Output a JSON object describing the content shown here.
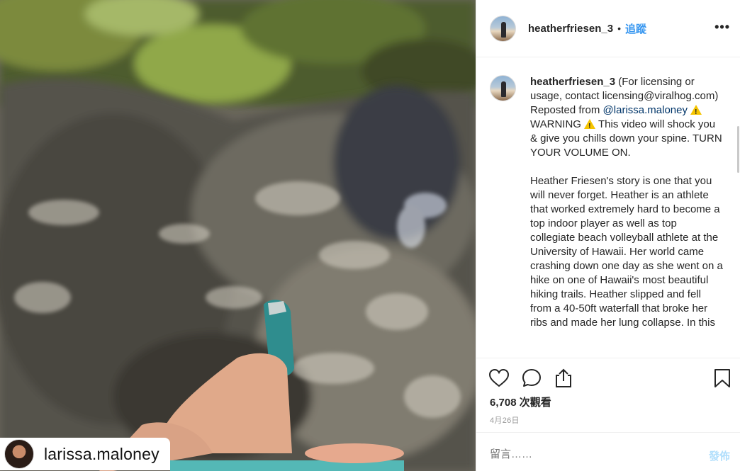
{
  "media": {
    "repost_tag": {
      "username": "larissa.maloney"
    }
  },
  "header": {
    "username": "heatherfriesen_3",
    "dot": "•",
    "follow_label": "追蹤",
    "more_label": "•••"
  },
  "caption": {
    "username": "heatherfriesen_3",
    "line1_part1": "(For licensing or usage, contact licensing@viralhog.com) Reposted from ",
    "mention": "@larissa.maloney",
    "warning_text_1": " WARNING ",
    "warning_text_2": " This video will shock you & give you chills down your spine. TURN YOUR VOLUME ON.",
    "paragraph2": "Heather Friesen's story is one that you will never forget. Heather is an athlete that worked extremely hard to become a top indoor player as well as top collegiate beach volleyball athlete at the University of Hawaii. Her world came crashing down one day as she went on a hike on one of Hawaii's most beautiful hiking trails. Heather slipped and fell from a 40-50ft waterfall that broke her ribs and made her lung collapse. In this"
  },
  "actions": {
    "like_icon": "heart-icon",
    "comment_icon": "comment-icon",
    "share_icon": "share-icon",
    "save_icon": "bookmark-icon",
    "views": "6,708 次觀看",
    "date": "4月26日"
  },
  "comment_box": {
    "placeholder": "留言……",
    "post_label": "發佈"
  },
  "colors": {
    "link_blue": "#3897f0",
    "post_disabled": "#b2dffc",
    "mention": "#003569"
  }
}
